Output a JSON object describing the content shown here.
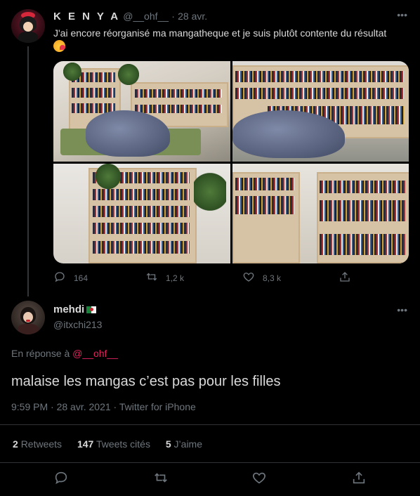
{
  "tweet1": {
    "display_name": "K E N Y A",
    "handle": "@__ohf__",
    "separator": "·",
    "time": "28 avr.",
    "text": "J'ai encore réorganisé ma mangatheque et je suis plutôt contente du résultat",
    "emoji": "smiling-face-with-hearts",
    "media_count": 4,
    "actions": {
      "reply_count": "164",
      "retweet_count": "1,2 k",
      "like_count": "8,3 k"
    }
  },
  "tweet2": {
    "display_name": "mehdi",
    "flag": "algeria-flag",
    "handle": "@itxchi213",
    "reply_to_prefix": "En réponse à",
    "reply_to_handle": "@__ohf__",
    "text": "malaise les mangas c’est pas pour les filles",
    "meta": "9:59 PM · 28 avr. 2021 · Twitter for iPhone",
    "stats": {
      "retweets_num": "2",
      "retweets_label": "Retweets",
      "quotes_num": "147",
      "quotes_label": "Tweets cités",
      "likes_num": "5",
      "likes_label": "J’aime"
    }
  },
  "colors": {
    "background": "#000000",
    "text": "#d9d9d9",
    "muted": "#6e767d",
    "divider": "#2f3336",
    "mention": "#e0245e"
  }
}
